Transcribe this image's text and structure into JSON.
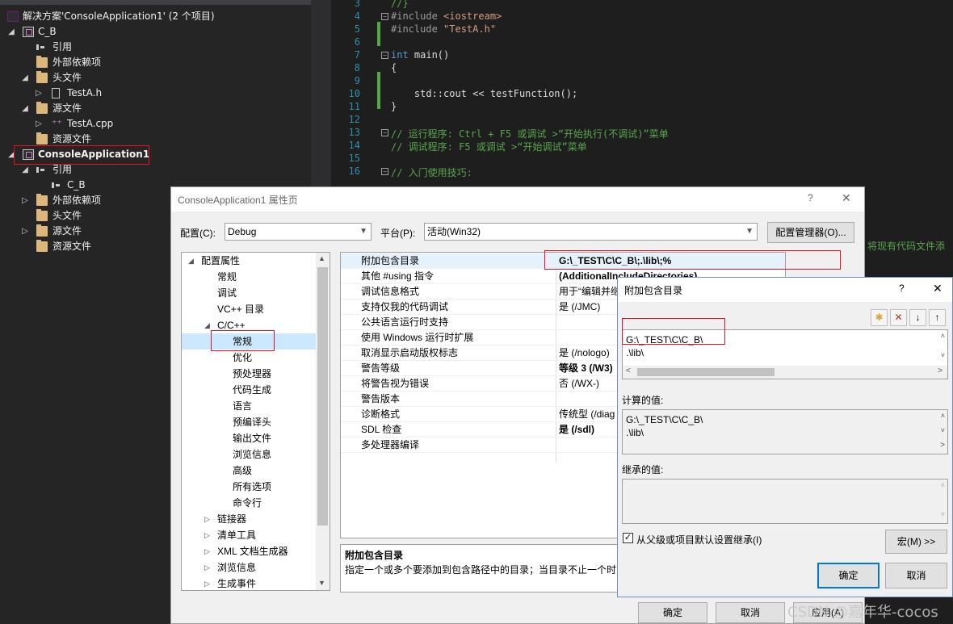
{
  "solution_explorer": {
    "solution": "解决方案'ConsoleApplication1' (2 个项目)",
    "items": [
      {
        "label": "C_B",
        "icon": "project-icon"
      },
      {
        "label": "引用",
        "icon": "reference-icon"
      },
      {
        "label": "外部依赖项",
        "icon": "folder-icon"
      },
      {
        "label": "头文件",
        "icon": "folder-icon"
      },
      {
        "label": "TestA.h",
        "icon": "header-file-icon"
      },
      {
        "label": "源文件",
        "icon": "folder-icon"
      },
      {
        "label": "TestA.cpp",
        "icon": "cpp-file-icon"
      },
      {
        "label": "资源文件",
        "icon": "folder-icon"
      },
      {
        "label": "ConsoleApplication1",
        "icon": "project-icon"
      },
      {
        "label": "引用",
        "icon": "reference-icon"
      },
      {
        "label": "C_B",
        "icon": "reference-icon"
      },
      {
        "label": "外部依赖项",
        "icon": "folder-icon"
      },
      {
        "label": "头文件",
        "icon": "folder-icon"
      },
      {
        "label": "源文件",
        "icon": "folder-icon"
      },
      {
        "label": "资源文件",
        "icon": "folder-icon"
      }
    ]
  },
  "editor": {
    "line_numbers": [
      "3",
      "4",
      "5",
      "6",
      "7",
      "8",
      "9",
      "10",
      "11",
      "12",
      "13",
      "14",
      "15",
      "16"
    ],
    "lines": [
      {
        "a": "//}",
        "b": "",
        "c": ""
      },
      {
        "a": "#include ",
        "b": "<iostream>",
        "c": ""
      },
      {
        "a": "#include ",
        "b": "\"TestA.h\"",
        "c": ""
      },
      {
        "a": "",
        "b": "",
        "c": ""
      },
      {
        "a": "int",
        "b": " main()",
        "c": ""
      },
      {
        "a": "{",
        "b": "",
        "c": ""
      },
      {
        "a": "",
        "b": "",
        "c": ""
      },
      {
        "a": "    std::cout << testFunction();",
        "b": "",
        "c": ""
      },
      {
        "a": "}",
        "b": "",
        "c": ""
      },
      {
        "a": "",
        "b": "",
        "c": ""
      },
      {
        "a": "// 运行程序: Ctrl + F5 或调试 >“开始执行(不调试)”菜单",
        "b": "",
        "c": ""
      },
      {
        "a": "// 调试程序: F5 或调试 >“开始调试”菜单",
        "b": "",
        "c": ""
      },
      {
        "a": "",
        "b": "",
        "c": ""
      },
      {
        "a": "// 入门使用技巧:",
        "b": "",
        "c": ""
      }
    ],
    "overflow_text": "将现有代码文件添"
  },
  "property_dialog": {
    "title": "ConsoleApplication1 属性页",
    "help": "?",
    "close": "✕",
    "config_label": "配置(C):",
    "config_value": "Debug",
    "platform_label": "平台(P):",
    "platform_value": "活动(Win32)",
    "config_manager": "配置管理器(O)...",
    "tree": [
      {
        "label": "配置属性",
        "indent": 0,
        "arrow": "◢"
      },
      {
        "label": "常规",
        "indent": 2,
        "arrow": ""
      },
      {
        "label": "调试",
        "indent": 2,
        "arrow": ""
      },
      {
        "label": "VC++ 目录",
        "indent": 2,
        "arrow": ""
      },
      {
        "label": "C/C++",
        "indent": 2,
        "arrow": "◢"
      },
      {
        "label": "常规",
        "indent": 3,
        "arrow": ""
      },
      {
        "label": "优化",
        "indent": 3,
        "arrow": ""
      },
      {
        "label": "预处理器",
        "indent": 3,
        "arrow": ""
      },
      {
        "label": "代码生成",
        "indent": 3,
        "arrow": ""
      },
      {
        "label": "语言",
        "indent": 3,
        "arrow": ""
      },
      {
        "label": "预编译头",
        "indent": 3,
        "arrow": ""
      },
      {
        "label": "输出文件",
        "indent": 3,
        "arrow": ""
      },
      {
        "label": "浏览信息",
        "indent": 3,
        "arrow": ""
      },
      {
        "label": "高级",
        "indent": 3,
        "arrow": ""
      },
      {
        "label": "所有选项",
        "indent": 3,
        "arrow": ""
      },
      {
        "label": "命令行",
        "indent": 3,
        "arrow": ""
      },
      {
        "label": "链接器",
        "indent": 1,
        "arrow": "▷"
      },
      {
        "label": "清单工具",
        "indent": 1,
        "arrow": "▷"
      },
      {
        "label": "XML 文档生成器",
        "indent": 1,
        "arrow": "▷"
      },
      {
        "label": "浏览信息",
        "indent": 1,
        "arrow": "▷"
      },
      {
        "label": "生成事件",
        "indent": 1,
        "arrow": "▷"
      }
    ],
    "grid": [
      {
        "name": "附加包含目录",
        "value": "G:\\_TEST\\C\\C_B\\;.\\lib\\;%(AdditionalIncludeDirectories)",
        "bold": true
      },
      {
        "name": "其他 #using 指令",
        "value": "",
        "bold": false
      },
      {
        "name": "调试信息格式",
        "value": "用于“编辑并继",
        "bold": false
      },
      {
        "name": "支持仅我的代码调试",
        "value": "是 (/JMC)",
        "bold": false
      },
      {
        "name": "公共语言运行时支持",
        "value": "",
        "bold": false
      },
      {
        "name": "使用 Windows 运行时扩展",
        "value": "",
        "bold": false
      },
      {
        "name": "取消显示启动版权标志",
        "value": "是 (/nologo)",
        "bold": false
      },
      {
        "name": "警告等级",
        "value": "等级 3 (/W3)",
        "bold": true
      },
      {
        "name": "将警告视为错误",
        "value": "否 (/WX-)",
        "bold": false
      },
      {
        "name": "警告版本",
        "value": "",
        "bold": false
      },
      {
        "name": "诊断格式",
        "value": "传统型 (/diag",
        "bold": false
      },
      {
        "name": "SDL 检查",
        "value": "是 (/sdl)",
        "bold": true
      },
      {
        "name": "多处理器编译",
        "value": "",
        "bold": false
      }
    ],
    "desc_title": "附加包含目录",
    "desc_text": "指定一个或多个要添加到包含路径中的目录；当目录不止一个时",
    "ok": "确定",
    "cancel": "取消",
    "apply": "应用(A)"
  },
  "include_dialog": {
    "title": "附加包含目录",
    "help": "?",
    "close": "✕",
    "entries": [
      "G:\\_TEST\\C\\C_B\\",
      ".\\lib\\"
    ],
    "computed_label": "计算的值:",
    "computed": [
      "G:\\_TEST\\C\\C_B\\",
      ".\\lib\\"
    ],
    "inherited_label": "继承的值:",
    "inherit_checkbox": "从父级或项目默认设置继承(I)",
    "macro_button": "宏(M) >>",
    "ok": "确定",
    "cancel": "取消"
  },
  "watermark": "CSDN @嘉年华-cocos"
}
